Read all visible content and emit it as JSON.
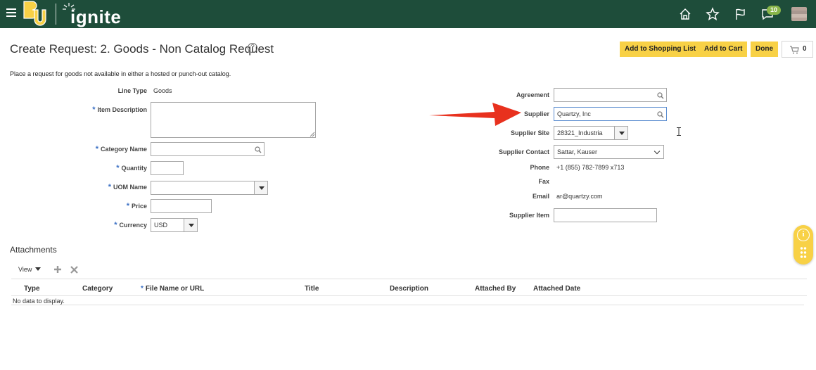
{
  "header": {
    "brand": "ignite",
    "notifications_count": "10",
    "icons": [
      "menu-icon",
      "home-icon",
      "star-icon",
      "flag-icon",
      "notification-icon",
      "avatar"
    ]
  },
  "page": {
    "title": "Create Request: 2. Goods - Non Catalog Request",
    "help_symbol": "?",
    "intro": "Place a request for goods not available in either a hosted or punch-out catalog."
  },
  "actions": {
    "add_to_shopping_list": "Add to Shopping List",
    "add_to_cart": "Add to Cart",
    "done": "Done",
    "cart_count": "0"
  },
  "form_left": {
    "line_type_label": "Line Type",
    "line_type_value": "Goods",
    "item_description_label": "Item Description",
    "item_description_value": "",
    "category_name_label": "Category Name",
    "category_name_value": "",
    "quantity_label": "Quantity",
    "quantity_value": "",
    "uom_name_label": "UOM Name",
    "uom_name_value": "",
    "price_label": "Price",
    "price_value": "",
    "currency_label": "Currency",
    "currency_value": "USD",
    "required_marker": "*"
  },
  "form_right": {
    "agreement_label": "Agreement",
    "agreement_value": "",
    "supplier_label": "Supplier",
    "supplier_value": "Quartzy, Inc",
    "supplier_site_label": "Supplier Site",
    "supplier_site_value": "28321_Industria",
    "supplier_contact_label": "Supplier Contact",
    "supplier_contact_value": "Sattar, Kauser",
    "phone_label": "Phone",
    "phone_value": "+1 (855) 782-7899 x713",
    "fax_label": "Fax",
    "fax_value": "",
    "email_label": "Email",
    "email_value": "ar@quartzy.com",
    "supplier_item_label": "Supplier Item",
    "supplier_item_value": ""
  },
  "attachments": {
    "title": "Attachments",
    "view_label": "View",
    "columns": [
      "Type",
      "Category",
      "File Name or URL",
      "Title",
      "Description",
      "Attached By",
      "Attached Date"
    ],
    "empty_text": "No data to display."
  },
  "colors": {
    "header_bg": "#1e4d3a",
    "accent_yellow": "#f8d146",
    "required_blue": "#3a6fc4",
    "annotation_arrow": "#e8311e"
  }
}
